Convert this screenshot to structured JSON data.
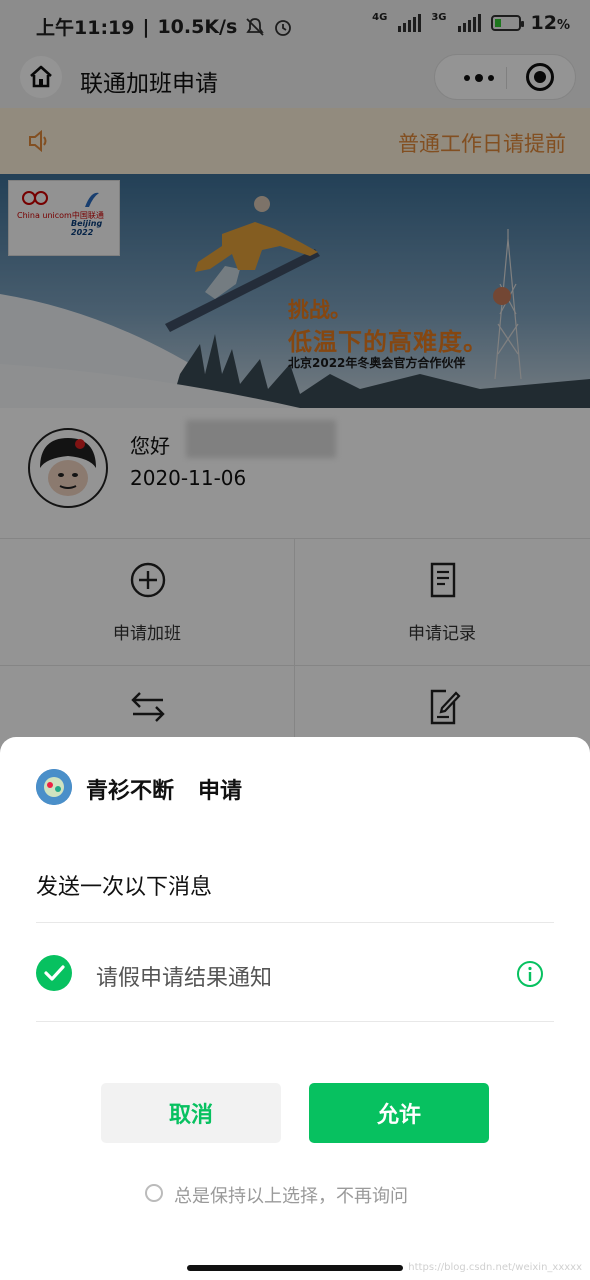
{
  "status_bar": {
    "time": "上午11:19",
    "speed": "10.5K/s",
    "signal1_label": "4G",
    "signal2_label": "3G",
    "battery_percent": "12",
    "battery_unit": "%"
  },
  "nav": {
    "title": "联通加班申请"
  },
  "notice": {
    "text": "普通工作日请提前"
  },
  "banner": {
    "slogan_line1": "挑战。",
    "slogan_line2": "低温下的高难度。",
    "slogan_line3": "北京2022年冬奥会官方合作伙伴",
    "logo_text1": "China unicom中国联通",
    "logo_text2": "Beijing 2022"
  },
  "profile": {
    "greeting": "您好",
    "date": "2020-11-06"
  },
  "menu": [
    {
      "label": "申请加班",
      "icon": "plus-circle-icon"
    },
    {
      "label": "申请记录",
      "icon": "document-list-icon"
    },
    {
      "label": "",
      "icon": "swap-arrows-icon"
    },
    {
      "label": "",
      "icon": "edit-document-icon"
    }
  ],
  "dialog": {
    "app_name": "青衫不断",
    "action": "申请",
    "send_desc": "发送一次以下消息",
    "message_item": "请假申请结果通知",
    "cancel_label": "取消",
    "allow_label": "允许",
    "always_label": "总是保持以上选择，不再询问",
    "watermark": "https://blog.csdn.net/weixin_xxxxx"
  },
  "colors": {
    "accent_green": "#07c160",
    "notice_orange": "#e0883a",
    "notice_bg": "#fbefd9"
  }
}
